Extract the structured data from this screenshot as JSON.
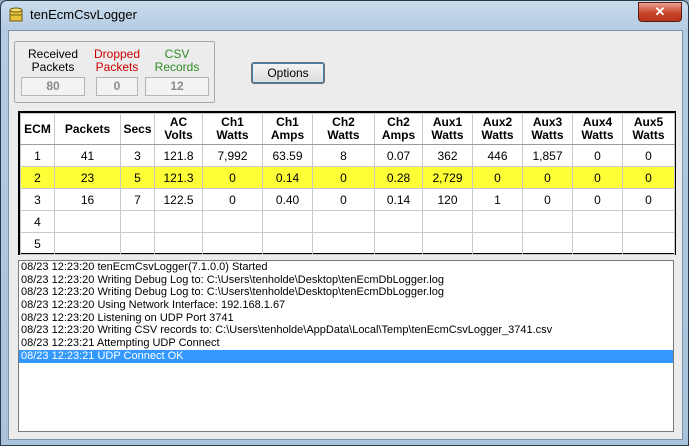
{
  "window": {
    "title": "tenEcmCsvLogger",
    "close_label": "✕"
  },
  "stats": {
    "received": {
      "label": "Received Packets",
      "value": "80"
    },
    "dropped": {
      "label": "Dropped Packets",
      "value": "0",
      "color": "#cc0000"
    },
    "csv": {
      "label": "CSV Records",
      "value": "12",
      "color": "#2e8b22"
    }
  },
  "options_label": "Options",
  "grid": {
    "headers": [
      "ECM",
      "Packets",
      "Secs",
      "AC\nVolts",
      "Ch1\nWatts",
      "Ch1\nAmps",
      "Ch2\nWatts",
      "Ch2\nAmps",
      "Aux1\nWatts",
      "Aux2\nWatts",
      "Aux3\nWatts",
      "Aux4\nWatts",
      "Aux5\nWatts"
    ],
    "rows": [
      [
        "1",
        "41",
        "3",
        "121.8",
        "7,992",
        "63.59",
        "8",
        "0.07",
        "362",
        "446",
        "1,857",
        "0",
        "0"
      ],
      [
        "2",
        "23",
        "5",
        "121.3",
        "0",
        "0.14",
        "0",
        "0.28",
        "2,729",
        "0",
        "0",
        "0",
        "0"
      ],
      [
        "3",
        "16",
        "7",
        "122.5",
        "0",
        "0.40",
        "0",
        "0.14",
        "120",
        "1",
        "0",
        "0",
        "0"
      ],
      [
        "4",
        "",
        "",
        "",
        "",
        "",
        "",
        "",
        "",
        "",
        "",
        "",
        ""
      ],
      [
        "5",
        "",
        "",
        "",
        "",
        "",
        "",
        "",
        "",
        "",
        "",
        "",
        ""
      ]
    ],
    "selected_row": 1,
    "selected_color": "#ffff38"
  },
  "log": [
    "08/23 12:23:20 tenEcmCsvLogger(7.1.0.0) Started",
    "08/23 12:23:20 Writing Debug Log to: C:\\Users\\tenholde\\Desktop\\tenEcmDbLogger.log",
    "08/23 12:23:20 Writing Debug Log to: C:\\Users\\tenholde\\Desktop\\tenEcmDbLogger.log",
    "08/23 12:23:20 Using Network Interface: 192.168.1.67",
    "08/23 12:23:20 Listening on UDP Port 3741",
    "08/23 12:23:20 Writing CSV records to: C:\\Users\\tenholde\\AppData\\Local\\Temp\\tenEcmCsvLogger_3741.csv",
    "08/23 12:23:21 Attempting UDP Connect",
    "08/23 12:23:21 UDP Connect OK"
  ],
  "log_selected": 7
}
